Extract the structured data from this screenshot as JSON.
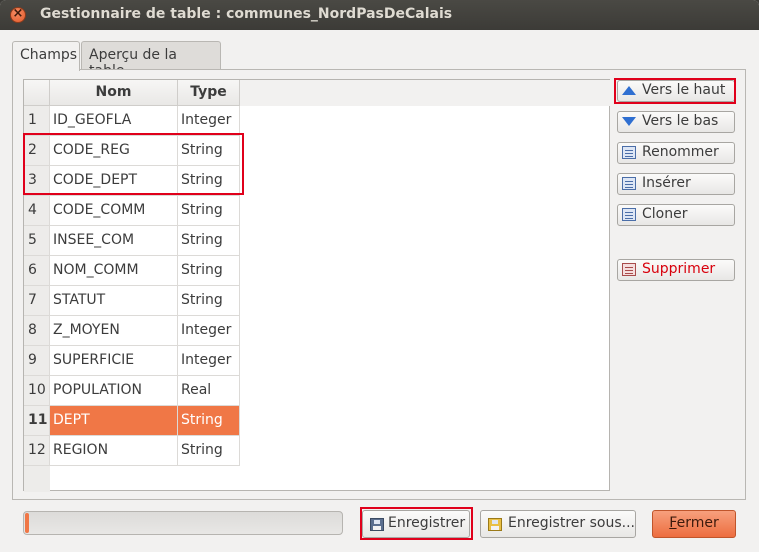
{
  "window": {
    "title": "Gestionnaire de table : communes_NordPasDeCalais"
  },
  "tabs": [
    {
      "label": "Champs",
      "active": true
    },
    {
      "label": "Aperçu de la table",
      "active": false
    }
  ],
  "table": {
    "columns": {
      "nom": "Nom",
      "type": "Type"
    },
    "rows": [
      {
        "num": "1",
        "nom": "ID_GEOFLA",
        "type": "Integer"
      },
      {
        "num": "2",
        "nom": "CODE_REG",
        "type": "String"
      },
      {
        "num": "3",
        "nom": "CODE_DEPT",
        "type": "String"
      },
      {
        "num": "4",
        "nom": "CODE_COMM",
        "type": "String"
      },
      {
        "num": "5",
        "nom": "INSEE_COM",
        "type": "String"
      },
      {
        "num": "6",
        "nom": "NOM_COMM",
        "type": "String"
      },
      {
        "num": "7",
        "nom": "STATUT",
        "type": "String"
      },
      {
        "num": "8",
        "nom": "Z_MOYEN",
        "type": "Integer"
      },
      {
        "num": "9",
        "nom": "SUPERFICIE",
        "type": "Integer"
      },
      {
        "num": "10",
        "nom": "POPULATION",
        "type": "Real"
      },
      {
        "num": "11",
        "nom": "DEPT",
        "type": "String"
      },
      {
        "num": "12",
        "nom": "REGION",
        "type": "String"
      }
    ],
    "selected_row": "11"
  },
  "side_buttons": {
    "up": "Vers le haut",
    "down": "Vers le bas",
    "rename": "Renommer",
    "insert": "Insérer",
    "clone": "Cloner",
    "delete": "Supprimer"
  },
  "bottom": {
    "progress_fraction": 0.01,
    "save": "Enregistrer",
    "save_as": "Enregistrer sous...",
    "close_mnemonic": "F",
    "close_rest": "ermer"
  },
  "colors": {
    "accent": "#f07746",
    "highlight_box": "#e0001b",
    "delete_text": "#d8000c"
  },
  "icons": {
    "close": "close-icon",
    "up": "arrow-up-icon",
    "down": "arrow-down-icon",
    "rename": "rename-icon",
    "insert": "insert-icon",
    "clone": "clone-icon",
    "delete": "delete-icon",
    "save": "floppy-icon",
    "save_as": "floppy-edit-icon"
  }
}
